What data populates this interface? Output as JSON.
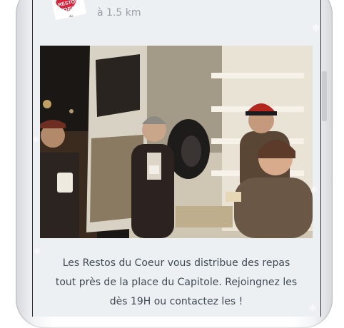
{
  "post": {
    "distance": "à 1.5 km",
    "logo_text": "RESTOS du COEUR",
    "description_lines": [
      "Les Restos du Coeur vous distribue des repas",
      "tout près de la place du Capitole. Rejoingnez les",
      "dès 19H ou contactez les !"
    ]
  },
  "colors": {
    "card_background": "#edf0f3",
    "muted_text": "#9aa0a8",
    "body_text": "#3f4a54",
    "logo_red": "#d9233a"
  }
}
